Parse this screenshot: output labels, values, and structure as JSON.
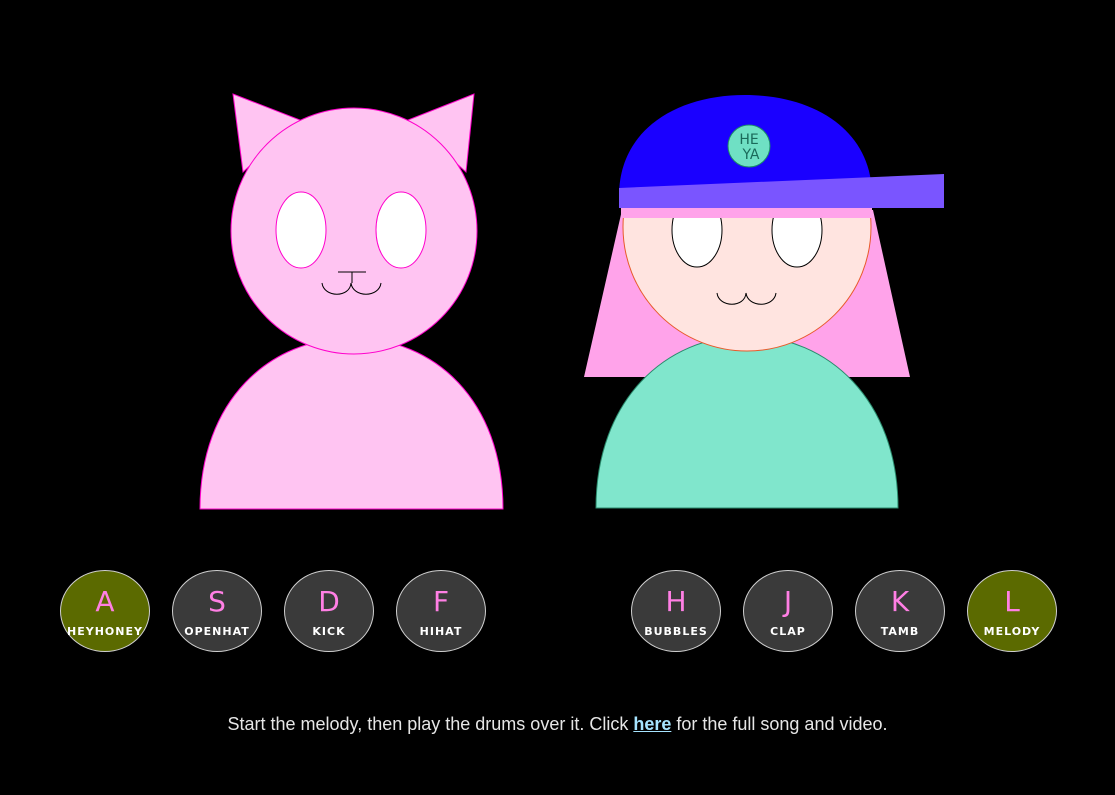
{
  "hat_badge": {
    "line1": "HE",
    "line2": "YA"
  },
  "pads": [
    {
      "key": "A",
      "name": "HEYHONEY",
      "active": true
    },
    {
      "key": "S",
      "name": "OPENHAT",
      "active": false
    },
    {
      "key": "D",
      "name": "KICK",
      "active": false
    },
    {
      "key": "F",
      "name": "HIHAT",
      "active": false
    },
    {
      "key": "H",
      "name": "BUBBLES",
      "active": false
    },
    {
      "key": "J",
      "name": "CLAP",
      "active": false
    },
    {
      "key": "K",
      "name": "TAMB",
      "active": false
    },
    {
      "key": "L",
      "name": "MELODY",
      "active": true
    }
  ],
  "footer": {
    "before": "Start the melody, then play the drums over it. Click ",
    "link": "here",
    "after": " for the full song and video."
  },
  "colors": {
    "cat_fill": "#ffc4f2",
    "cat_stroke": "#ff00cc",
    "girl_skin": "#ffe4e0",
    "girl_hair": "#ffa3ea",
    "girl_shirt": "#80e6cc",
    "hat": "#1a00ff",
    "hat_brim": "#7a55ff",
    "badge": "#6fe0c4",
    "pad_active": "#5b6a00",
    "pad_inactive": "#3a3a3a",
    "pad_key": "#ff7fe4",
    "link": "#a6e4ff"
  }
}
